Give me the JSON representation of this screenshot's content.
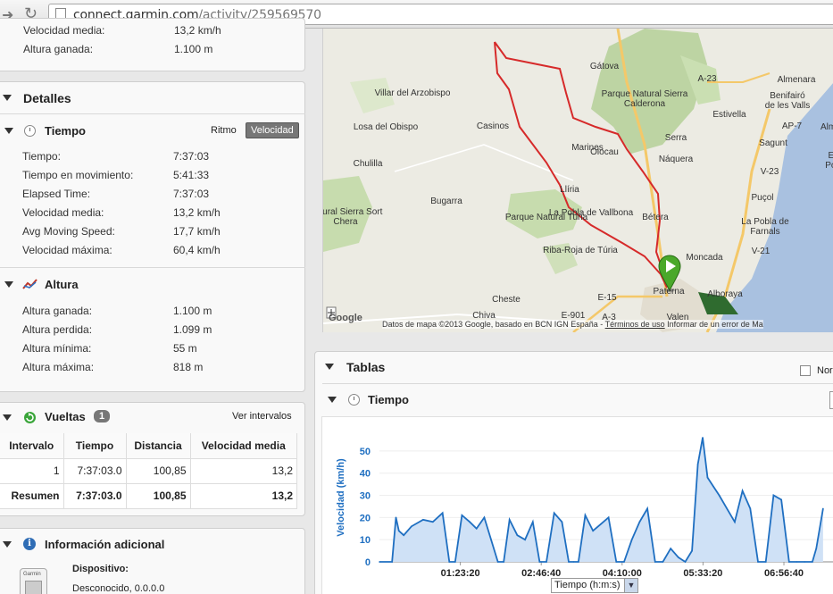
{
  "browser": {
    "back_icon": "arrow-right-icon",
    "reload_icon": "reload-icon",
    "url_host": "connect.garmin.com",
    "url_path": "/activity/259569570"
  },
  "summary_top": {
    "cut_label": "Velocidad media:",
    "cut_value": "13,2 km/h",
    "gain_label": "Altura ganada:",
    "gain_value": "1.100 m"
  },
  "details": {
    "title": "Detalles",
    "time": {
      "title": "Tiempo",
      "toggle_pace": "Ritmo",
      "toggle_speed": "Velocidad",
      "rows": [
        {
          "label": "Tiempo:",
          "value": "7:37:03"
        },
        {
          "label": "Tiempo en movimiento:",
          "value": "5:41:33"
        },
        {
          "label": "Elapsed Time:",
          "value": "7:37:03"
        },
        {
          "label": "Velocidad media:",
          "value": "13,2 km/h"
        },
        {
          "label": "Avg Moving Speed:",
          "value": "17,7 km/h"
        },
        {
          "label": "Velocidad máxima:",
          "value": "60,4 km/h"
        }
      ]
    },
    "elevation": {
      "title": "Altura",
      "rows": [
        {
          "label": "Altura ganada:",
          "value": "1.100 m"
        },
        {
          "label": "Altura perdida:",
          "value": "1.099 m"
        },
        {
          "label": "Altura mínima:",
          "value": "55 m"
        },
        {
          "label": "Altura máxima:",
          "value": "818 m"
        }
      ]
    }
  },
  "laps": {
    "title": "Vueltas",
    "count": "1",
    "link": "Ver intervalos",
    "headers": [
      "Intervalo",
      "Tiempo",
      "Distancia",
      "Velocidad media"
    ],
    "rows": [
      [
        "1",
        "7:37:03.0",
        "100,85",
        "13,2"
      ],
      [
        "Resumen",
        "7:37:03.0",
        "100,85",
        "13,2"
      ]
    ]
  },
  "extra_info": {
    "title": "Información adicional",
    "device_label": "Dispositivo:",
    "device_value": "Desconocido, 0.0.0.0",
    "device_icon_text": "Garmin"
  },
  "map": {
    "labels": [
      "Gátova",
      "A-23",
      "Almenara",
      "Villar del Arzobispo",
      "Parque Natural Sierra Calderona",
      "Benifairó de les Valls",
      "AP-7",
      "Estivella",
      "Almar",
      "Losa del Obispo",
      "Casinos",
      "Olocau",
      "Serra",
      "Sagunt",
      "Marines",
      "Náquera",
      "El Por",
      "Chulilla",
      "V-23",
      "Llíria",
      "Puçol",
      "Bugarra",
      "Parque Natural Turia",
      "La Pobla de Vallbona",
      "Bétera",
      "La Pobla de Farnals",
      "Natural Sierra Sort Chera",
      "V-21",
      "Riba-Roja de Túria",
      "Moncada",
      "E-15",
      "Paterna",
      "Alboraya",
      "Cheste",
      "Chiva",
      "E-901",
      "A-3",
      "Valen"
    ],
    "attribution": "Datos de mapa ©2013 Google, basado en BCN IGN España",
    "terms": "Términos de uso",
    "report": "Informar de un error de Ma",
    "google": "Google",
    "marker_icon": "start-marker-icon"
  },
  "tables": {
    "title": "Tablas",
    "checkbox_label": "Nor",
    "time_section": "Tiempo",
    "x_select": "Tiempo (h:m:s)"
  },
  "chart_data": {
    "type": "area",
    "ylabel": "Velocidad (km/h)",
    "xlabel": "Tiempo (h:m:s)",
    "ylim": [
      0,
      58
    ],
    "yticks": [
      "0",
      "10",
      "20",
      "30",
      "40",
      "50"
    ],
    "xticks": [
      "01:23:20",
      "02:46:40",
      "04:10:00",
      "05:33:20",
      "06:56:40"
    ],
    "x": [
      "00:00:00",
      "00:13:00",
      "00:17:00",
      "00:20:00",
      "00:25:00",
      "00:33:00",
      "00:45:00",
      "00:55:00",
      "01:05:00",
      "01:12:00",
      "01:18:00",
      "01:25:00",
      "01:33:00",
      "01:40:00",
      "01:48:00",
      "01:55:00",
      "02:02:00",
      "02:08:00",
      "02:14:00",
      "02:22:00",
      "02:30:00",
      "02:38:00",
      "02:45:00",
      "02:52:00",
      "03:00:00",
      "03:08:00",
      "03:15:00",
      "03:20:00",
      "03:25:00",
      "03:32:00",
      "03:40:00",
      "03:48:00",
      "03:56:00",
      "04:04:00",
      "04:12:00",
      "04:20:00",
      "04:28:00",
      "04:36:00",
      "04:44:00",
      "04:52:00",
      "05:00:00",
      "05:08:00",
      "05:15:00",
      "05:22:00",
      "05:28:00",
      "05:33:00",
      "05:38:00",
      "05:44:00",
      "05:50:00",
      "05:58:00",
      "06:06:00",
      "06:14:00",
      "06:22:00",
      "06:30:00",
      "06:38:00",
      "06:46:00",
      "06:54:00",
      "07:02:00",
      "07:10:00",
      "07:18:00",
      "07:26:00",
      "07:30:00",
      "07:37:00"
    ],
    "series": [
      {
        "values": [
          0,
          0,
          20,
          14,
          12,
          16,
          19,
          18,
          22,
          0,
          0,
          21,
          18,
          15,
          20,
          10,
          0,
          0,
          19,
          12,
          10,
          18,
          0,
          0,
          22,
          18,
          0,
          0,
          0,
          21,
          14,
          17,
          20,
          0,
          0,
          10,
          18,
          24,
          0,
          0,
          6,
          2,
          0,
          5,
          44,
          56,
          38,
          34,
          30,
          24,
          18,
          32,
          24,
          0,
          0,
          30,
          28,
          0,
          0,
          0,
          0,
          6,
          24
        ]
      }
    ]
  },
  "colors": {
    "accent_blue": "#1f6fc1",
    "area_fill": "#cfe1f6",
    "route_red": "#d62a2a",
    "marker_green": "#4aa82a"
  }
}
